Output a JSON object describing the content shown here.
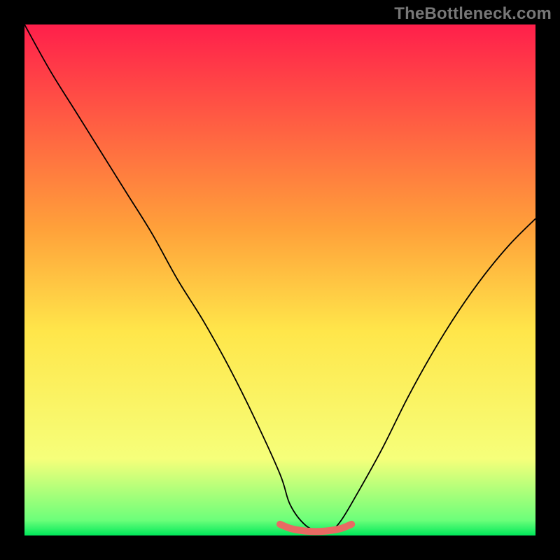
{
  "watermark": "TheBottleneck.com",
  "chart_data": {
    "type": "line",
    "title": "",
    "xlabel": "",
    "ylabel": "",
    "xlim": [
      0,
      100
    ],
    "ylim": [
      0,
      100
    ],
    "grid": false,
    "legend": false,
    "background_gradient": {
      "stops": [
        {
          "offset": 0.0,
          "color": "#ff1f4b"
        },
        {
          "offset": 0.4,
          "color": "#ffa13a"
        },
        {
          "offset": 0.6,
          "color": "#ffe64a"
        },
        {
          "offset": 0.85,
          "color": "#f6ff7a"
        },
        {
          "offset": 0.97,
          "color": "#6cff7a"
        },
        {
          "offset": 1.0,
          "color": "#00e85a"
        }
      ]
    },
    "series": [
      {
        "name": "bottleneck-curve",
        "color": "#000000",
        "width": 1.8,
        "x": [
          0,
          5,
          10,
          15,
          20,
          25,
          30,
          35,
          40,
          45,
          50,
          52,
          55,
          58,
          60,
          62,
          65,
          70,
          75,
          80,
          85,
          90,
          95,
          100
        ],
        "y": [
          100,
          91,
          83,
          75,
          67,
          59,
          50,
          42,
          33,
          23,
          12,
          6,
          2,
          0.8,
          1.0,
          3,
          8,
          17,
          27,
          36,
          44,
          51,
          57,
          62
        ]
      },
      {
        "name": "optimal-band",
        "color": "#e96a63",
        "width": 10,
        "x": [
          50,
          52,
          54,
          56,
          58,
          60,
          62,
          64
        ],
        "y": [
          2.2,
          1.4,
          1.0,
          0.8,
          0.8,
          1.0,
          1.4,
          2.2
        ]
      }
    ]
  }
}
